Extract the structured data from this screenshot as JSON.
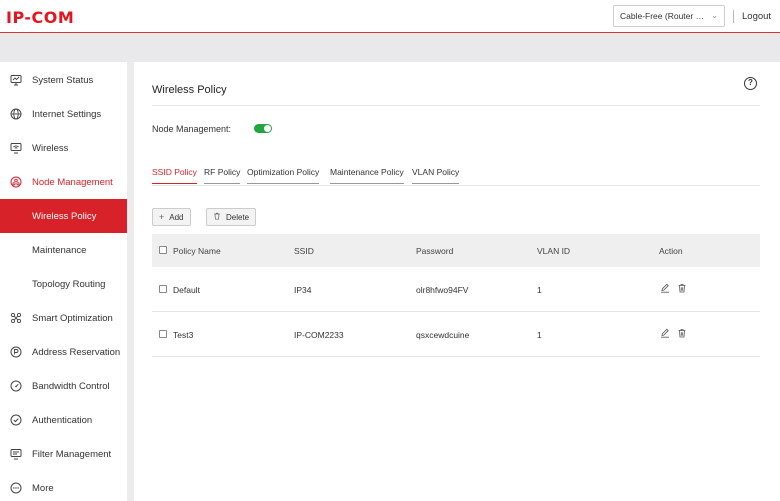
{
  "header": {
    "logo": "IP-COM",
    "mode_select": "Cable-Free (Router M...",
    "logout": "Logout"
  },
  "sidebar": {
    "items": [
      {
        "label": "System Status",
        "icon": "monitor-icon"
      },
      {
        "label": "Internet Settings",
        "icon": "globe-icon"
      },
      {
        "label": "Wireless",
        "icon": "wifi-icon"
      },
      {
        "label": "Node Management",
        "icon": "node-icon"
      },
      {
        "label": "Wireless Policy",
        "icon": ""
      },
      {
        "label": "Maintenance",
        "icon": ""
      },
      {
        "label": "Topology Routing",
        "icon": ""
      },
      {
        "label": "Smart Optimization",
        "icon": "optimize-icon"
      },
      {
        "label": "Address Reservation",
        "icon": "address-icon"
      },
      {
        "label": "Bandwidth Control",
        "icon": "gauge-icon"
      },
      {
        "label": "Authentication",
        "icon": "shield-icon"
      },
      {
        "label": "Filter Management",
        "icon": "filter-icon"
      },
      {
        "label": "More",
        "icon": "more-icon"
      }
    ],
    "active_parent": "Node Management",
    "active_item": "Wireless Policy"
  },
  "main": {
    "title": "Wireless Policy",
    "node_management_label": "Node Management:",
    "node_management_enabled": true,
    "tabs": [
      {
        "label": "SSID Policy",
        "active": true
      },
      {
        "label": "RF Policy",
        "active": false
      },
      {
        "label": "Optimization Policy",
        "active": false
      },
      {
        "label": "Maintenance Policy",
        "active": false
      },
      {
        "label": "VLAN Policy",
        "active": false
      }
    ],
    "buttons": {
      "add": "Add",
      "delete": "Delete"
    },
    "table": {
      "columns": [
        "Policy Name",
        "SSID",
        "Password",
        "VLAN ID",
        "Action"
      ],
      "rows": [
        {
          "policy_name": "Default",
          "ssid": "IP34",
          "password": "olr8hfwo94FV",
          "vlan_id": "1"
        },
        {
          "policy_name": "Test3",
          "ssid": "IP-COM2233",
          "password": "qsxcewdcuine",
          "vlan_id": "1"
        }
      ]
    }
  },
  "colors": {
    "brand_red": "#d8222a",
    "toggle_green": "#23a642"
  }
}
